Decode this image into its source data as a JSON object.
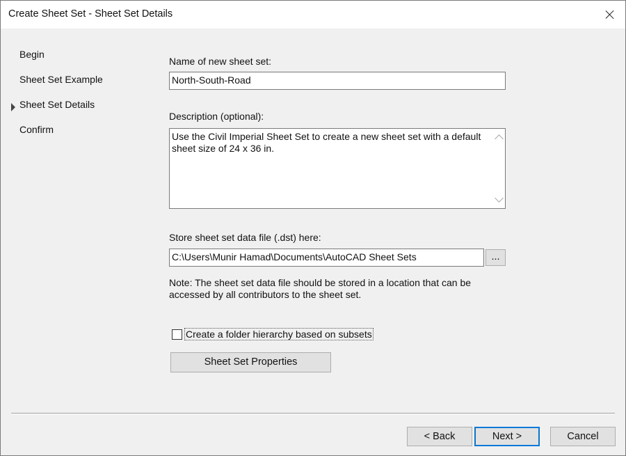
{
  "window": {
    "title": "Create Sheet Set - Sheet Set Details"
  },
  "steps": [
    {
      "label": "Begin",
      "active": false
    },
    {
      "label": "Sheet Set Example",
      "active": false
    },
    {
      "label": "Sheet Set Details",
      "active": true
    },
    {
      "label": "Confirm",
      "active": false
    }
  ],
  "form": {
    "name_label": "Name of new sheet set:",
    "name_value": "North-South-Road",
    "description_label": "Description (optional):",
    "description_value": "Use the Civil Imperial Sheet Set to create a new sheet set with a default sheet size of 24 x 36 in.",
    "store_label": "Store sheet set data file (.dst) here:",
    "store_value": "C:\\Users\\Munir Hamad\\Documents\\AutoCAD Sheet Sets",
    "browse_label": "...",
    "note": "Note: The sheet set data file should be stored in a location that can be accessed by all contributors to the sheet set.",
    "checkbox_label": "Create a folder hierarchy based on subsets",
    "checkbox_checked": false,
    "properties_button": "Sheet Set Properties"
  },
  "footer": {
    "back_label": "< Back",
    "next_label": "Next >",
    "cancel_label": "Cancel"
  },
  "icons": [
    "close-icon",
    "step-pointer-icon",
    "scroll-up-icon",
    "scroll-down-icon"
  ]
}
